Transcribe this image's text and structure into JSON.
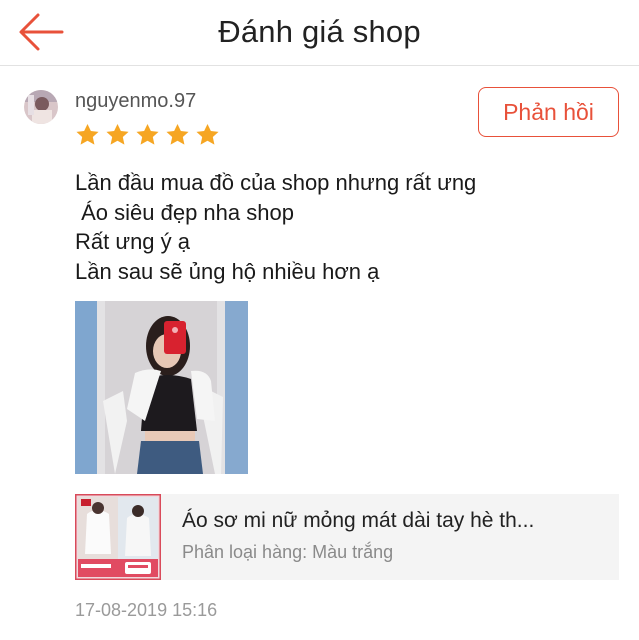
{
  "header": {
    "title": "Đánh giá shop",
    "back_icon": "arrow-left-icon",
    "accent_color": "#e8513a"
  },
  "review": {
    "username": "nguyenmo.97",
    "rating": 5,
    "rating_max": 5,
    "star_color": "#f6a623",
    "reply_label": "Phản hồi",
    "comment_lines": [
      "Lần đầu mua đồ của shop nhưng rất ưng",
      " Áo siêu đẹp nha shop",
      "Rất ưng ý ạ",
      "Lần sau sẽ ủng hộ nhiều hơn ạ"
    ],
    "product": {
      "name": "Áo sơ mi nữ mỏng mát dài tay hè th...",
      "variant": "Phân loại hàng: Màu trắng"
    },
    "timestamp": "17-08-2019 15:16"
  }
}
